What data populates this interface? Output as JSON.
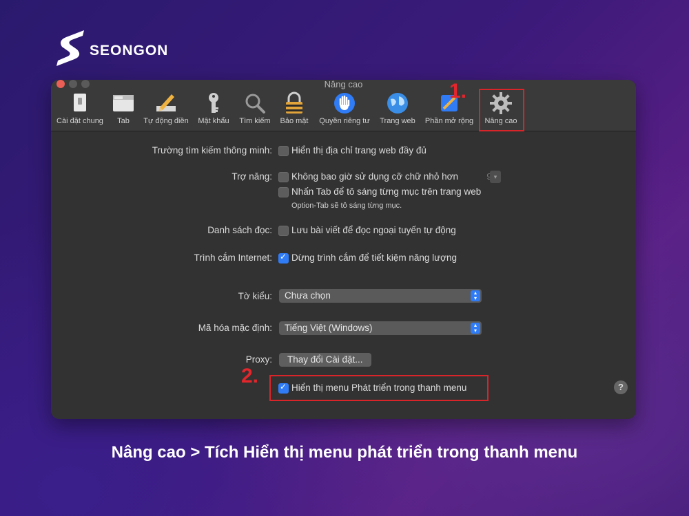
{
  "brand": {
    "name": "SEONGON"
  },
  "window": {
    "title": "Nâng cao",
    "toolbar": [
      {
        "label": "Cài đặt chung",
        "icon": "switch-icon"
      },
      {
        "label": "Tab",
        "icon": "tabs-icon"
      },
      {
        "label": "Tự động điền",
        "icon": "pencil-icon"
      },
      {
        "label": "Mật khẩu",
        "icon": "key-icon"
      },
      {
        "label": "Tìm kiếm",
        "icon": "search-icon"
      },
      {
        "label": "Bảo mật",
        "icon": "lock-icon"
      },
      {
        "label": "Quyền riêng tư",
        "icon": "hand-icon"
      },
      {
        "label": "Trang web",
        "icon": "globe-icon"
      },
      {
        "label": "Phần mở rộng",
        "icon": "puzzle-icon"
      },
      {
        "label": "Nâng cao",
        "icon": "gear-icon"
      }
    ]
  },
  "settings": {
    "smart_search": {
      "label": "Trường tìm kiếm thông minh:",
      "option": "Hiển thị địa chỉ trang web đầy đủ",
      "checked": false
    },
    "accessibility": {
      "label": "Trợ năng:",
      "option1": "Không bao giờ sử dụng cỡ chữ nhỏ hơn",
      "font_size": "9",
      "option2": "Nhấn Tab để tô sáng từng mục trên trang web",
      "hint": "Option-Tab sẽ tô sáng từng mục."
    },
    "reading_list": {
      "label": "Danh sách đọc:",
      "option": "Lưu bài viết để đọc ngoại tuyến tự động",
      "checked": false
    },
    "plugins": {
      "label": "Trình cắm Internet:",
      "option": "Dừng trình cắm để tiết kiệm năng lượng",
      "checked": true
    },
    "style_sheet": {
      "label": "Tờ kiểu:",
      "value": "Chưa chọn"
    },
    "encoding": {
      "label": "Mã hóa mặc định:",
      "value": "Tiếng Việt (Windows)"
    },
    "proxy": {
      "label": "Proxy:",
      "button": "Thay đổi Cài đặt..."
    },
    "develop_menu": {
      "option": "Hiển thị menu Phát triển trong thanh menu",
      "checked": true
    },
    "help": "?"
  },
  "annotations": {
    "step1": "1.",
    "step2": "2.",
    "color": "#d9252a"
  },
  "caption": "Nâng cao > Tích Hiển thị menu phát triển trong thanh menu"
}
